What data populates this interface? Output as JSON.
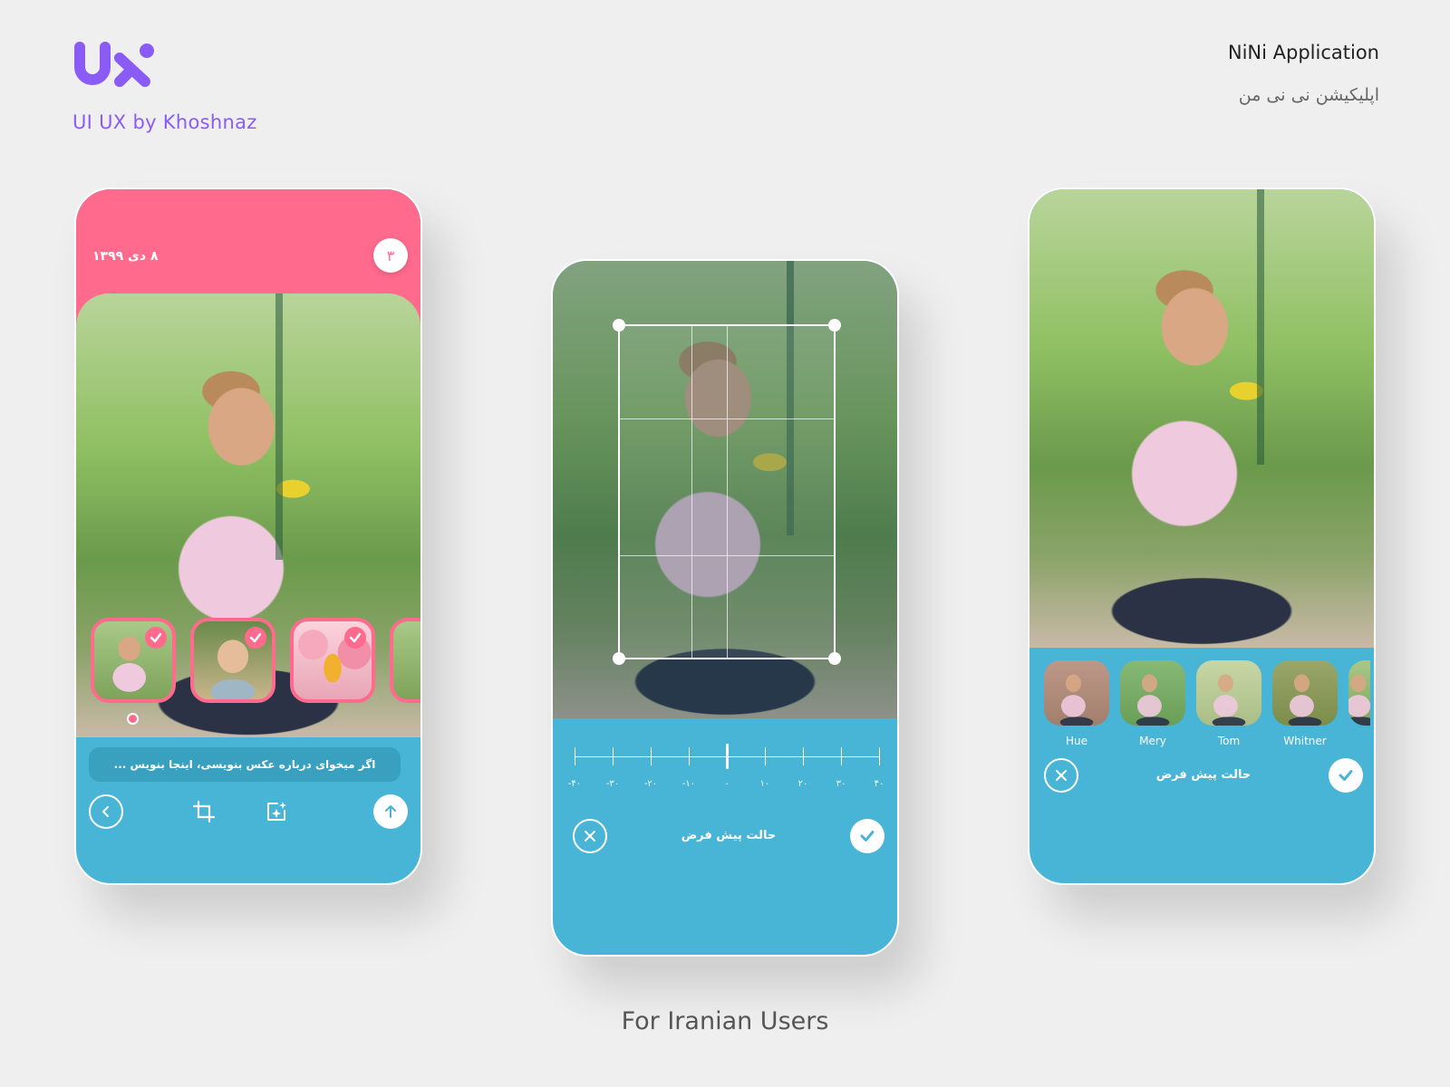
{
  "brand": {
    "logo_text": "UX",
    "caption": "UI UX by Khoshnaz",
    "color": "#8a5cf5"
  },
  "app": {
    "title_en": "NiNi Application",
    "title_fa": "اپلیکیشن نی نی من"
  },
  "footer": {
    "caption": "For Iranian Users"
  },
  "colors": {
    "pink": "#ff6a8d",
    "blue": "#48b5d6",
    "background": "#efefef"
  },
  "screen_compose": {
    "date": "۸ دی ۱۳۹۹",
    "photo_count": "۳",
    "thumbnails": [
      {
        "name": "baby-eating-corn",
        "selected": true
      },
      {
        "name": "baby-crawling",
        "selected": true
      },
      {
        "name": "girl-with-balloons",
        "selected": true
      },
      {
        "name": "baby-partial",
        "selected": false
      }
    ],
    "caption_placeholder": "اگر میخوای درباره عکس بنویسی، اینجا بنویس ...",
    "toolbar": {
      "back": "chevron-left-icon",
      "crop": "crop-icon",
      "effects": "sparkle-image-icon",
      "upload": "arrow-up-icon"
    }
  },
  "screen_crop": {
    "rotation_value": 0,
    "ruler_labels": [
      "-۴۰",
      "-۳۰",
      "-۲۰",
      "-۱۰",
      "۰",
      "۱۰",
      "۲۰",
      "۳۰",
      "۴۰"
    ],
    "reset_label": "حالت پیش فرض"
  },
  "screen_filters": {
    "filters": [
      {
        "name": "Hue",
        "tint": "rgba(230,60,140,0.35)"
      },
      {
        "name": "Mery",
        "tint": "rgba(60,150,80,0.3)"
      },
      {
        "name": "Tom",
        "tint": "rgba(255,240,220,0.35)"
      },
      {
        "name": "Whitner",
        "tint": "rgba(120,90,40,0.3)"
      }
    ],
    "reset_label": "حالت پیش فرض"
  }
}
